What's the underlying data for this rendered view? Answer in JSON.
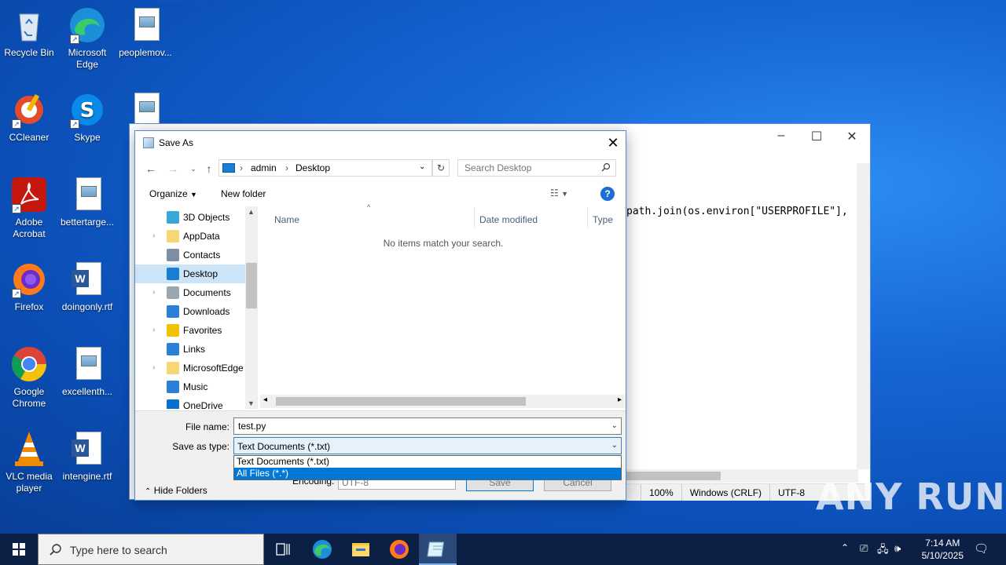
{
  "desktop": {
    "icons": [
      {
        "label": "Recycle Bin"
      },
      {
        "label": "Microsoft Edge"
      },
      {
        "label": "peoplemov..."
      },
      {
        "label": "CCleaner"
      },
      {
        "label": "Skype"
      },
      {
        "label": "Adobe Acrobat"
      },
      {
        "label": "bettertarge..."
      },
      {
        "label": "Firefox"
      },
      {
        "label": "doingonly.rtf"
      },
      {
        "label": "Google Chrome"
      },
      {
        "label": "excellenth..."
      },
      {
        "label": "VLC media player"
      },
      {
        "label": "intengine.rtf"
      }
    ]
  },
  "notepad": {
    "code_line": "path.join(os.environ[\"USERPROFILE\"],",
    "status": {
      "zoom": "100%",
      "line_ending": "Windows (CRLF)",
      "encoding": "UTF-8"
    }
  },
  "dialog": {
    "title": "Save As",
    "address": {
      "crumbs": [
        "admin",
        "Desktop"
      ]
    },
    "search": {
      "placeholder": "Search Desktop"
    },
    "toolbar": {
      "organize": "Organize",
      "new_folder": "New folder",
      "help": "?"
    },
    "nav_items": [
      {
        "label": "3D Objects",
        "expandable": false
      },
      {
        "label": "AppData",
        "expandable": true
      },
      {
        "label": "Contacts",
        "expandable": false
      },
      {
        "label": "Desktop",
        "expandable": false,
        "selected": true
      },
      {
        "label": "Documents",
        "expandable": true
      },
      {
        "label": "Downloads",
        "expandable": false
      },
      {
        "label": "Favorites",
        "expandable": true
      },
      {
        "label": "Links",
        "expandable": false
      },
      {
        "label": "MicrosoftEdge",
        "expandable": true
      },
      {
        "label": "Music",
        "expandable": false
      },
      {
        "label": "OneDrive",
        "expandable": false
      }
    ],
    "columns": [
      "Name",
      "Date modified",
      "Type"
    ],
    "empty_message": "No items match your search.",
    "file_name_label": "File name:",
    "file_name_value": "test.py",
    "save_type_label": "Save as type:",
    "save_type_value": "Text Documents (*.txt)",
    "save_type_options": [
      "Text Documents (*.txt)",
      "All Files  (*.*)"
    ],
    "highlighted_option_index": 1,
    "encoding_label": "Encoding:",
    "encoding_value": "UTF-8",
    "hide_folders": "Hide Folders",
    "save_button": "Save",
    "cancel_button": "Cancel"
  },
  "taskbar": {
    "search_placeholder": "Type here to search",
    "time": "7:14 AM",
    "date": "5/10/2025"
  },
  "watermark": "ANY RUN",
  "colors": {
    "accent": "#0078d7",
    "selection": "#cce4f7",
    "taskbar": "#0c2045"
  }
}
